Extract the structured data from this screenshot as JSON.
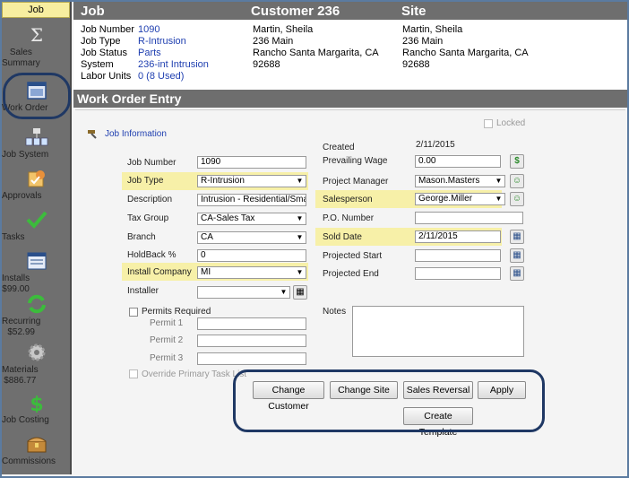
{
  "sidebar": {
    "header": "Job",
    "items": [
      {
        "label": "Sales\nSummary",
        "icon": "sigma-icon"
      },
      {
        "label": "Work Order",
        "icon": "work-order-icon"
      },
      {
        "label": "Job System",
        "icon": "job-system-icon"
      },
      {
        "label": "Approvals",
        "icon": "approvals-icon"
      },
      {
        "label": "Tasks",
        "icon": "checkmark-icon"
      },
      {
        "label": "Installs\n$99.00",
        "icon": "installs-icon"
      },
      {
        "label": "Recurring\n$52.99",
        "icon": "recurring-icon"
      },
      {
        "label": "Materials\n$886.77",
        "icon": "gear-icon"
      },
      {
        "label": "Job Costing",
        "icon": "dollar-icon"
      },
      {
        "label": "Commissions",
        "icon": "treasure-chest-icon"
      }
    ]
  },
  "header": {
    "job": "Job",
    "customer": "Customer 236",
    "site": "Site"
  },
  "job_info": {
    "job_number_label": "Job Number",
    "job_number": "1090",
    "job_type_label": "Job Type",
    "job_type": "R-Intrusion",
    "job_status_label": "Job Status",
    "job_status": "Parts",
    "system_label": "System",
    "system": "236-int Intrusion",
    "labor_units_label": "Labor Units",
    "labor_units": "0 (8 Used)"
  },
  "customer": {
    "name": "Martin, Sheila",
    "address": "236 Main",
    "city": "Rancho Santa Margarita, CA",
    "zip": "92688"
  },
  "site": {
    "name": "Martin, Sheila",
    "address": "236 Main",
    "city": "Rancho Santa Margarita, CA",
    "zip": "92688"
  },
  "section_title": "Work Order Entry",
  "form": {
    "locked_label": "Locked",
    "job_info_link": "Job Information",
    "job_number_label": "Job Number",
    "job_number": "1090",
    "job_type_label": "Job Type",
    "job_type": "R-Intrusion",
    "description_label": "Description",
    "description": "Intrusion - Residential/Small Co",
    "tax_group_label": "Tax Group",
    "tax_group": "CA-Sales Tax",
    "branch_label": "Branch",
    "branch": "CA",
    "holdback_label": "HoldBack  %",
    "holdback": "0",
    "install_company_label": "Install Company",
    "install_company": "MI",
    "installer_label": "Installer",
    "installer": "",
    "permits_required_label": "Permits Required",
    "permit1_label": "Permit 1",
    "permit2_label": "Permit 2",
    "permit3_label": "Permit 3",
    "override_label": "Override Primary Task List",
    "created_label": "Created",
    "created": "2/11/2015",
    "prevailing_wage_label": "Prevailing Wage",
    "prevailing_wage": "0.00",
    "project_manager_label": "Project Manager",
    "project_manager": "Mason.Masters",
    "salesperson_label": "Salesperson",
    "salesperson": "George.Miller",
    "po_number_label": "P.O. Number",
    "po_number": "",
    "sold_date_label": "Sold Date",
    "sold_date": "2/11/2015",
    "projected_start_label": "Projected Start",
    "projected_start": "",
    "projected_end_label": "Projected End",
    "projected_end": "",
    "notes_label": "Notes"
  },
  "buttons": {
    "change_customer": "Change Customer",
    "change_site": "Change Site",
    "sales_reversal": "Sales Reversal",
    "apply": "Apply",
    "create_template": "Create Template"
  },
  "colors": {
    "highlight": "#f7f0a8",
    "header_gray": "#6e6e6e",
    "link_blue": "#1f3fb0",
    "callout_border": "#1f3864",
    "sidebar_header": "#f7eea0"
  }
}
